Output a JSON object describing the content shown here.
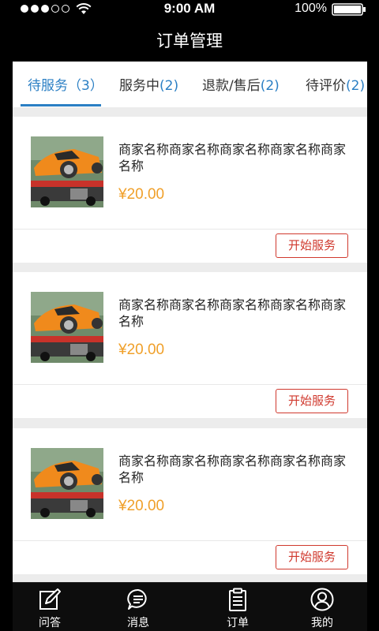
{
  "status_bar": {
    "time": "9:00 AM",
    "battery": "100%"
  },
  "nav": {
    "title": "订单管理"
  },
  "tabs": [
    {
      "label": "待服务",
      "count": "（3）"
    },
    {
      "label": "服务中",
      "count": "(2)"
    },
    {
      "label": "退款/售后",
      "count": "(2)"
    },
    {
      "label": "待评价",
      "count": "(2)"
    }
  ],
  "orders": [
    {
      "name": "商家名称商家名称商家名称商家名称商家名称",
      "price": "¥20.00",
      "action": "开始服务"
    },
    {
      "name": "商家名称商家名称商家名称商家名称商家名称",
      "price": "¥20.00",
      "action": "开始服务"
    },
    {
      "name": "商家名称商家名称商家名称商家名称商家名称",
      "price": "¥20.00",
      "action": "开始服务"
    }
  ],
  "tabbar": [
    {
      "label": "问答",
      "icon": "edit-icon"
    },
    {
      "label": "消息",
      "icon": "message-icon"
    },
    {
      "label": "订单",
      "icon": "clipboard-icon"
    },
    {
      "label": "我的",
      "icon": "user-icon"
    }
  ],
  "colors": {
    "accent": "#2b7fc4",
    "price": "#f0a02a",
    "action": "#d0392e"
  }
}
